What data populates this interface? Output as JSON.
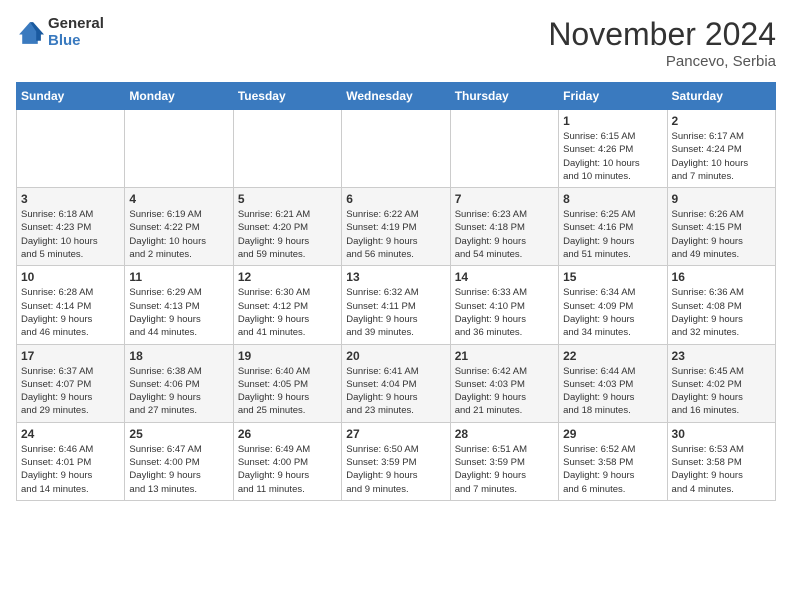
{
  "header": {
    "logo_general": "General",
    "logo_blue": "Blue",
    "month_title": "November 2024",
    "location": "Pancevo, Serbia"
  },
  "weekdays": [
    "Sunday",
    "Monday",
    "Tuesday",
    "Wednesday",
    "Thursday",
    "Friday",
    "Saturday"
  ],
  "weeks": [
    [
      {
        "day": "",
        "info": ""
      },
      {
        "day": "",
        "info": ""
      },
      {
        "day": "",
        "info": ""
      },
      {
        "day": "",
        "info": ""
      },
      {
        "day": "",
        "info": ""
      },
      {
        "day": "1",
        "info": "Sunrise: 6:15 AM\nSunset: 4:26 PM\nDaylight: 10 hours\nand 10 minutes."
      },
      {
        "day": "2",
        "info": "Sunrise: 6:17 AM\nSunset: 4:24 PM\nDaylight: 10 hours\nand 7 minutes."
      }
    ],
    [
      {
        "day": "3",
        "info": "Sunrise: 6:18 AM\nSunset: 4:23 PM\nDaylight: 10 hours\nand 5 minutes."
      },
      {
        "day": "4",
        "info": "Sunrise: 6:19 AM\nSunset: 4:22 PM\nDaylight: 10 hours\nand 2 minutes."
      },
      {
        "day": "5",
        "info": "Sunrise: 6:21 AM\nSunset: 4:20 PM\nDaylight: 9 hours\nand 59 minutes."
      },
      {
        "day": "6",
        "info": "Sunrise: 6:22 AM\nSunset: 4:19 PM\nDaylight: 9 hours\nand 56 minutes."
      },
      {
        "day": "7",
        "info": "Sunrise: 6:23 AM\nSunset: 4:18 PM\nDaylight: 9 hours\nand 54 minutes."
      },
      {
        "day": "8",
        "info": "Sunrise: 6:25 AM\nSunset: 4:16 PM\nDaylight: 9 hours\nand 51 minutes."
      },
      {
        "day": "9",
        "info": "Sunrise: 6:26 AM\nSunset: 4:15 PM\nDaylight: 9 hours\nand 49 minutes."
      }
    ],
    [
      {
        "day": "10",
        "info": "Sunrise: 6:28 AM\nSunset: 4:14 PM\nDaylight: 9 hours\nand 46 minutes."
      },
      {
        "day": "11",
        "info": "Sunrise: 6:29 AM\nSunset: 4:13 PM\nDaylight: 9 hours\nand 44 minutes."
      },
      {
        "day": "12",
        "info": "Sunrise: 6:30 AM\nSunset: 4:12 PM\nDaylight: 9 hours\nand 41 minutes."
      },
      {
        "day": "13",
        "info": "Sunrise: 6:32 AM\nSunset: 4:11 PM\nDaylight: 9 hours\nand 39 minutes."
      },
      {
        "day": "14",
        "info": "Sunrise: 6:33 AM\nSunset: 4:10 PM\nDaylight: 9 hours\nand 36 minutes."
      },
      {
        "day": "15",
        "info": "Sunrise: 6:34 AM\nSunset: 4:09 PM\nDaylight: 9 hours\nand 34 minutes."
      },
      {
        "day": "16",
        "info": "Sunrise: 6:36 AM\nSunset: 4:08 PM\nDaylight: 9 hours\nand 32 minutes."
      }
    ],
    [
      {
        "day": "17",
        "info": "Sunrise: 6:37 AM\nSunset: 4:07 PM\nDaylight: 9 hours\nand 29 minutes."
      },
      {
        "day": "18",
        "info": "Sunrise: 6:38 AM\nSunset: 4:06 PM\nDaylight: 9 hours\nand 27 minutes."
      },
      {
        "day": "19",
        "info": "Sunrise: 6:40 AM\nSunset: 4:05 PM\nDaylight: 9 hours\nand 25 minutes."
      },
      {
        "day": "20",
        "info": "Sunrise: 6:41 AM\nSunset: 4:04 PM\nDaylight: 9 hours\nand 23 minutes."
      },
      {
        "day": "21",
        "info": "Sunrise: 6:42 AM\nSunset: 4:03 PM\nDaylight: 9 hours\nand 21 minutes."
      },
      {
        "day": "22",
        "info": "Sunrise: 6:44 AM\nSunset: 4:03 PM\nDaylight: 9 hours\nand 18 minutes."
      },
      {
        "day": "23",
        "info": "Sunrise: 6:45 AM\nSunset: 4:02 PM\nDaylight: 9 hours\nand 16 minutes."
      }
    ],
    [
      {
        "day": "24",
        "info": "Sunrise: 6:46 AM\nSunset: 4:01 PM\nDaylight: 9 hours\nand 14 minutes."
      },
      {
        "day": "25",
        "info": "Sunrise: 6:47 AM\nSunset: 4:00 PM\nDaylight: 9 hours\nand 13 minutes."
      },
      {
        "day": "26",
        "info": "Sunrise: 6:49 AM\nSunset: 4:00 PM\nDaylight: 9 hours\nand 11 minutes."
      },
      {
        "day": "27",
        "info": "Sunrise: 6:50 AM\nSunset: 3:59 PM\nDaylight: 9 hours\nand 9 minutes."
      },
      {
        "day": "28",
        "info": "Sunrise: 6:51 AM\nSunset: 3:59 PM\nDaylight: 9 hours\nand 7 minutes."
      },
      {
        "day": "29",
        "info": "Sunrise: 6:52 AM\nSunset: 3:58 PM\nDaylight: 9 hours\nand 6 minutes."
      },
      {
        "day": "30",
        "info": "Sunrise: 6:53 AM\nSunset: 3:58 PM\nDaylight: 9 hours\nand 4 minutes."
      }
    ]
  ]
}
